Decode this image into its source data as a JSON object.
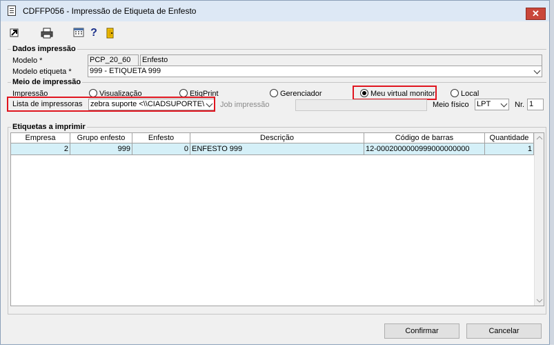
{
  "window": {
    "title": "CDFFP056 - Impressão de Etiqueta de Enfesto",
    "close_glyph": "✕"
  },
  "toolbar": {
    "icons": [
      "arrow-icon",
      "printer-icon",
      "calculator-icon",
      "help-icon",
      "exit-door-icon"
    ]
  },
  "dados": {
    "legend": "Dados impressão",
    "modelo_label": "Modelo *",
    "modelo_code": "PCP_20_60",
    "modelo_desc": "Enfesto",
    "etiqueta_label": "Modelo etiqueta *",
    "etiqueta_value": "999 - ETIQUETA 999"
  },
  "meio": {
    "legend": "Meio de impressão",
    "impressao_label": "Impressão",
    "options": [
      {
        "label": "Visualização",
        "checked": false
      },
      {
        "label": "EtiqPrint",
        "checked": false
      },
      {
        "label": "Gerenciador",
        "checked": false
      },
      {
        "label": "Meu virtual monitor",
        "checked": true
      },
      {
        "label": "Local",
        "checked": false
      }
    ],
    "lista_label": "Lista de impressoras",
    "lista_value": "zebra suporte <\\\\CIADSUPORTE\\",
    "job_label": "Job impressão",
    "job_value": "",
    "meio_fisico_label": "Meio físico",
    "meio_fisico_value": "LPT",
    "nr_label": "Nr.",
    "nr_value": "1"
  },
  "etiquetas": {
    "legend": "Etiquetas a imprimir",
    "columns": [
      "Empresa",
      "Grupo enfesto",
      "Enfesto",
      "Descrição",
      "Código de barras",
      "Quantidade"
    ],
    "rows": [
      [
        "2",
        "999",
        "0",
        "ENFESTO 999",
        "12-0002000000999000000000",
        "1"
      ]
    ]
  },
  "buttons": {
    "confirmar": "Confirmar",
    "cancelar": "Cancelar"
  },
  "colors": {
    "highlight": "#e0141e",
    "row_selected": "#d5f0f8",
    "close_button": "#c9473b"
  }
}
